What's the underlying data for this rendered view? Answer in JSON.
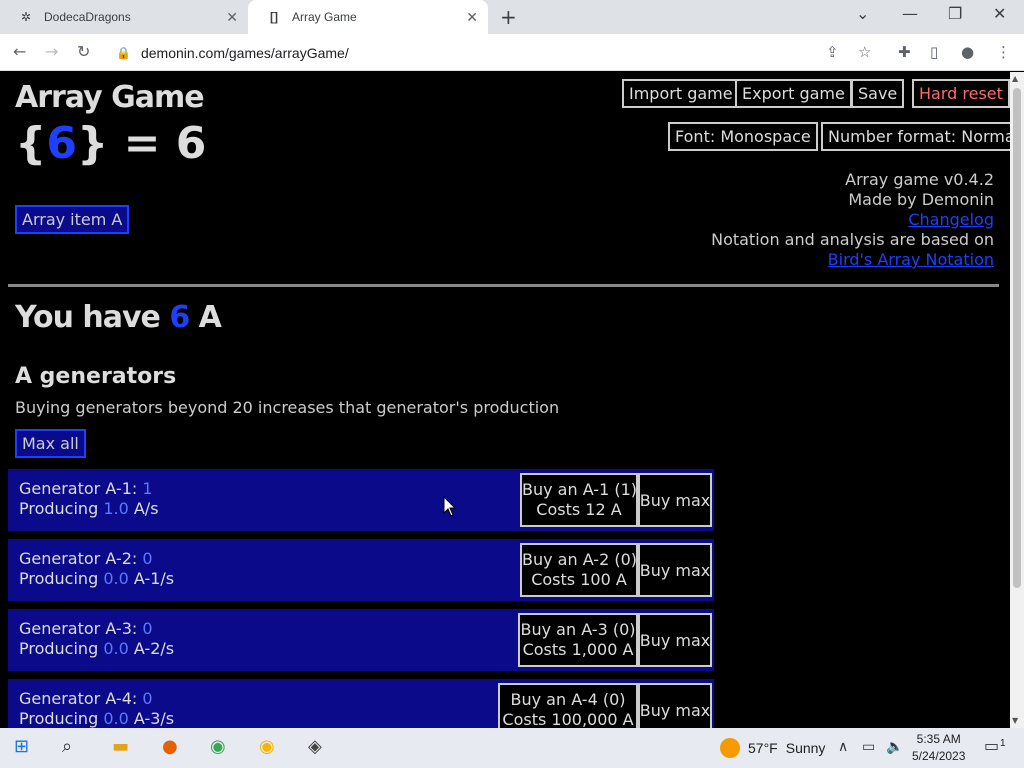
{
  "browser": {
    "tabs": [
      {
        "title": "DodecaDragons",
        "active": false
      },
      {
        "title": "Array Game",
        "active": true
      }
    ],
    "url": "demonin.com/games/arrayGame/"
  },
  "game": {
    "title": "Array Game",
    "expr_open": "{",
    "expr_value": "6",
    "expr_close": "} = 6",
    "array_item_button": "Array item A",
    "buttons": {
      "import": "Import game",
      "export": "Export game",
      "save": "Save",
      "hard_reset": "Hard reset",
      "font": "Font: Monospace",
      "number_format": "Number format: Normal"
    },
    "info": {
      "version": "Array game v0.4.2",
      "author": "Made by Demonin",
      "changelog": "Changelog",
      "notation_text": "Notation and analysis are based on",
      "notation_link": "Bird's Array Notation"
    },
    "you_have_prefix": "You have",
    "you_have_value": "6",
    "you_have_suffix": "A",
    "generators_title": "A generators",
    "generators_desc": "Buying generators beyond 20 increases that generator's production",
    "max_all": "Max all",
    "generators": [
      {
        "name": "Generator A-1:",
        "count": "1",
        "produce_label": "Producing",
        "rate": "1.0",
        "unit": "A/s",
        "buy_line1": "Buy an A-1 (1)",
        "buy_line2": "Costs 12 A",
        "buy_max": "Buy max"
      },
      {
        "name": "Generator A-2:",
        "count": "0",
        "produce_label": "Producing",
        "rate": "0.0",
        "unit": "A-1/s",
        "buy_line1": "Buy an A-2 (0)",
        "buy_line2": "Costs 100 A",
        "buy_max": "Buy max"
      },
      {
        "name": "Generator A-3:",
        "count": "0",
        "produce_label": "Producing",
        "rate": "0.0",
        "unit": "A-2/s",
        "buy_line1": "Buy an A-3 (0)",
        "buy_line2": "Costs 1,000 A",
        "buy_max": "Buy max"
      },
      {
        "name": "Generator A-4:",
        "count": "0",
        "produce_label": "Producing",
        "rate": "0.0",
        "unit": "A-3/s",
        "buy_line1": "Buy an A-4 (0)",
        "buy_line2": "Costs 100,000 A",
        "buy_max": "Buy max"
      }
    ]
  },
  "taskbar": {
    "weather_temp": "57°F",
    "weather_text": "Sunny",
    "time": "5:35 AM",
    "date": "5/24/2023",
    "notif_count": "1"
  },
  "colors": {
    "accent_blue": "#1f3fff",
    "generator_bg": "#0a0a8a",
    "hard_reset": "#ff6a6a"
  }
}
